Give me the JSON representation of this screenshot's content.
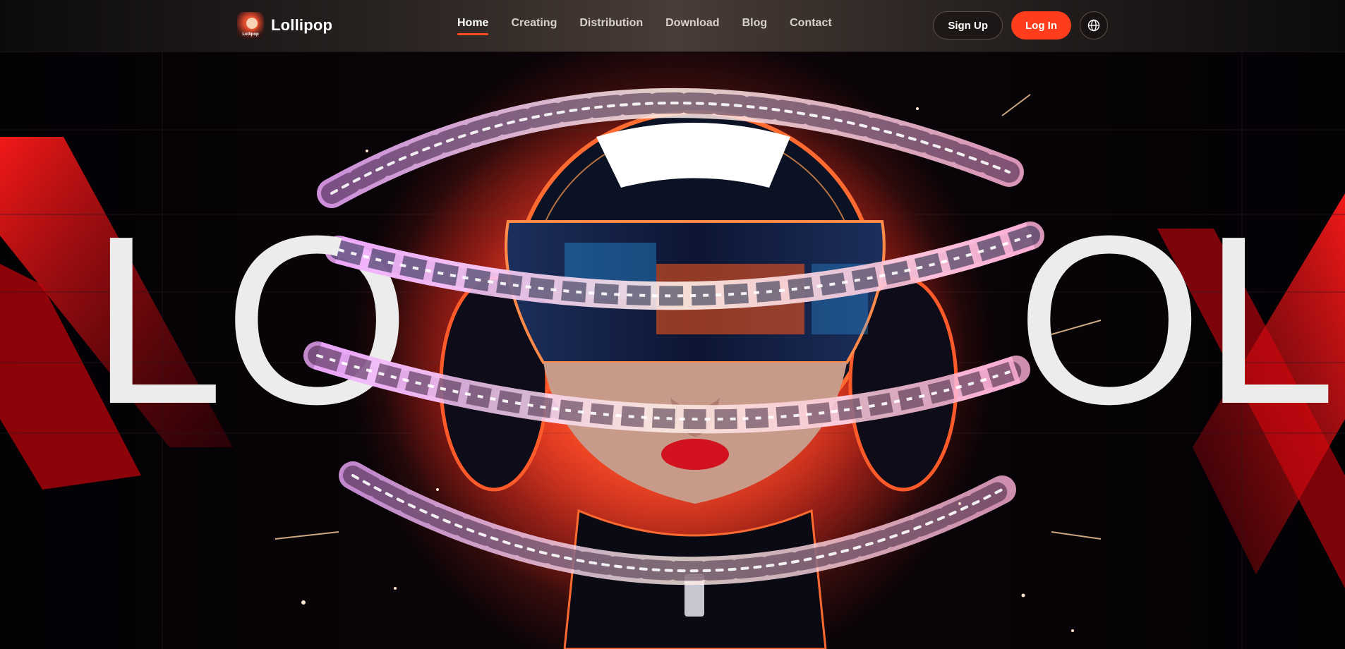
{
  "brand": {
    "name": "Lollipop",
    "logo_text": "Lollipop"
  },
  "nav": {
    "items": [
      {
        "label": "Home",
        "active": true
      },
      {
        "label": "Creating",
        "active": false
      },
      {
        "label": "Distribution",
        "active": false
      },
      {
        "label": "Download",
        "active": false
      },
      {
        "label": "Blog",
        "active": false
      },
      {
        "label": "Contact",
        "active": false
      }
    ]
  },
  "auth": {
    "signup_label": "Sign Up",
    "login_label": "Log In",
    "language_icon": "globe-icon"
  },
  "hero": {
    "letters_left": "LO",
    "letters_right": "OL"
  },
  "colors": {
    "accent": "#ff3d1c",
    "active_underline": "#ff4b22",
    "hero_red": "#e4261e"
  }
}
